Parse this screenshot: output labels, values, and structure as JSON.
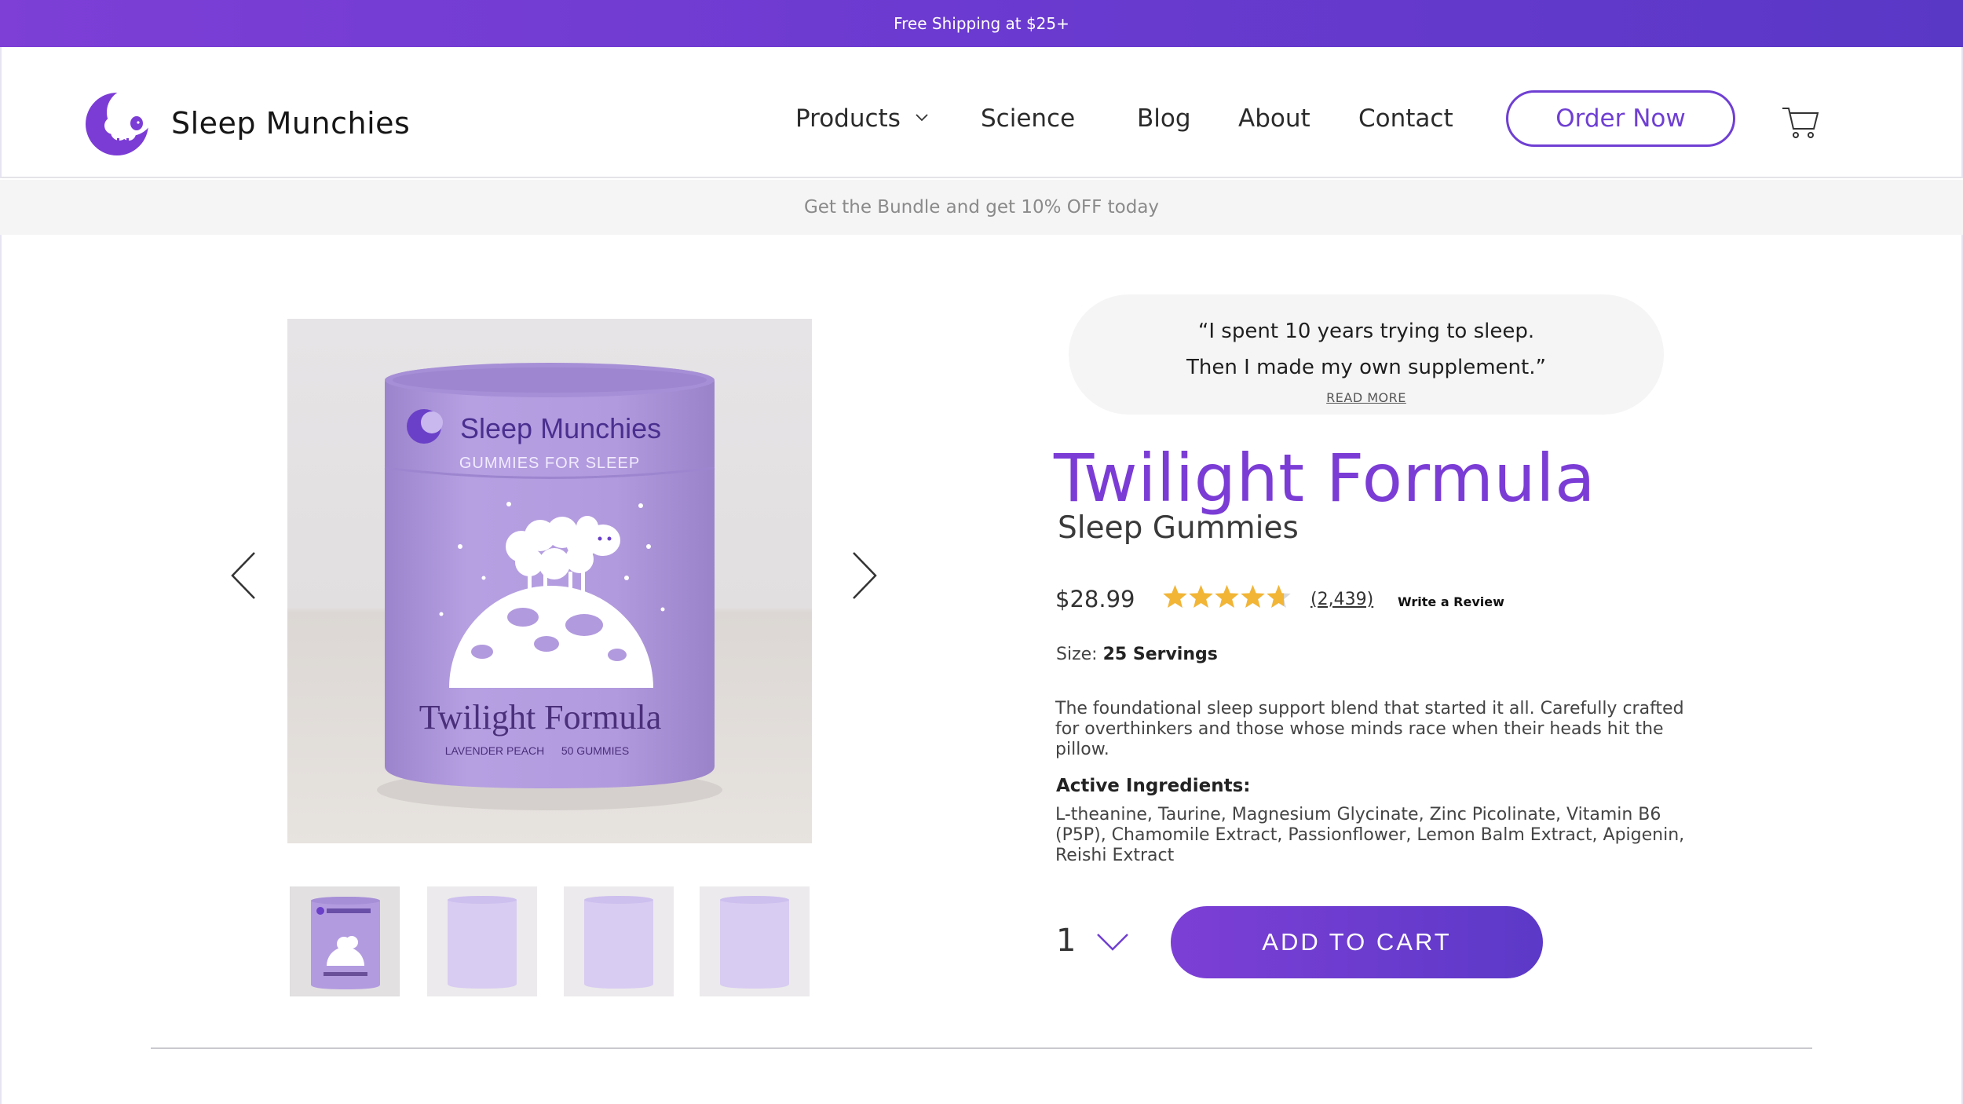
{
  "top_banner": {
    "text": "Free Shipping at $25+"
  },
  "header": {
    "brand": "Sleep Munchies",
    "nav": {
      "products": "Products",
      "science": "Science",
      "blog": "Blog",
      "about": "About",
      "contact": "Contact"
    },
    "order_button": "Order Now"
  },
  "promo": {
    "text": "Get the Bundle and get 10% OFF today"
  },
  "gallery": {
    "product_label_brand": "Sleep Munchies",
    "product_label_tagline": "GUMMIES FOR SLEEP",
    "product_label_name": "Twilight Formula",
    "product_label_flavor": "LAVENDER PEACH",
    "product_label_count": "50 GUMMIES",
    "thumbnails": 4
  },
  "testimonial": {
    "line1": "“I spent 10 years trying to sleep.",
    "line2": "Then I made my own supplement.”",
    "read_more": "READ MORE"
  },
  "product": {
    "title": "Twilight Formula",
    "subtitle": "Sleep Gummies",
    "price": "$28.99",
    "rating": 4.7,
    "rating_max": 5,
    "review_count": "(2,439)",
    "write_review": "Write a Review",
    "size_label": "Size:",
    "size_value": "25 Servings",
    "description": "The foundational sleep support blend that started it all. Carefully crafted for overthinkers and those whose minds race when their heads hit the pillow.",
    "ingredients_title": "Active Ingredients:",
    "ingredients": "L-theanine, Taurine, Magnesium Glycinate, Zinc Picolinate, Vitamin B6 (P5P), Chamomile Extract, Passionflower, Lemon Balm Extract, Apigenin, Reishi Extract",
    "quantity": "1",
    "add_to_cart": "ADD TO CART"
  },
  "colors": {
    "brand_purple": "#7b3cd6",
    "product_lilac": "#b39be0",
    "star_gold": "#f2b535"
  }
}
